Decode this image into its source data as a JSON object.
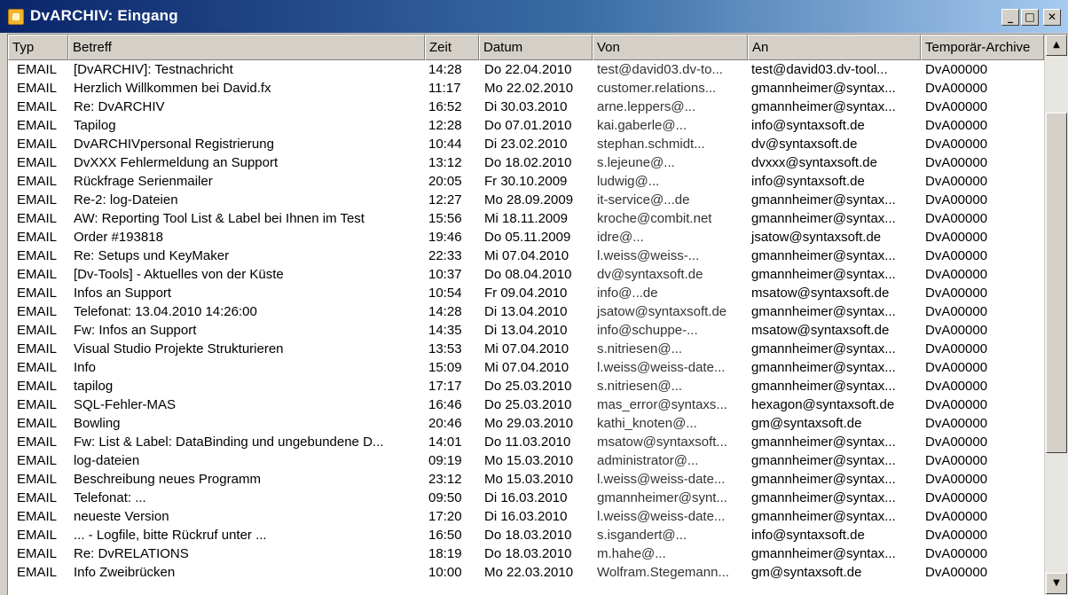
{
  "window": {
    "title": "DvARCHIV: Eingang",
    "buttons": {
      "minimize": "_",
      "maximize": "□",
      "close": "✕"
    }
  },
  "columns": [
    "Typ",
    "Betreff",
    "Zeit",
    "Datum",
    "Von",
    "An",
    "Temporär-Archive"
  ],
  "rows": [
    [
      "EMAIL",
      "[DvARCHIV]: Testnachricht",
      "14:28",
      "Do 22.04.2010",
      "test@david03.dv-to...",
      "test@david03.dv-tool...",
      "DvA00000"
    ],
    [
      "EMAIL",
      "Herzlich Willkommen bei David.fx",
      "11:17",
      "Mo 22.02.2010",
      "customer.relations...",
      "gmannheimer@syntax...",
      "DvA00000"
    ],
    [
      "EMAIL",
      "Re: DvARCHIV",
      "16:52",
      "Di 30.03.2010",
      "arne.leppers@...",
      "gmannheimer@syntax...",
      "DvA00000"
    ],
    [
      "EMAIL",
      "Tapilog",
      "12:28",
      "Do 07.01.2010",
      "kai.gaberle@...",
      "info@syntaxsoft.de",
      "DvA00000"
    ],
    [
      "EMAIL",
      "DvARCHIVpersonal Registrierung",
      "10:44",
      "Di 23.02.2010",
      "stephan.schmidt...",
      "dv@syntaxsoft.de",
      "DvA00000"
    ],
    [
      "EMAIL",
      "DvXXX Fehlermeldung an Support",
      "13:12",
      "Do 18.02.2010",
      "s.lejeune@...",
      "dvxxx@syntaxsoft.de",
      "DvA00000"
    ],
    [
      "EMAIL",
      "Rückfrage Serienmailer",
      "20:05",
      "Fr 30.10.2009",
      "ludwig@...",
      "info@syntaxsoft.de",
      "DvA00000"
    ],
    [
      "EMAIL",
      "Re-2: log-Dateien",
      "12:27",
      "Mo 28.09.2009",
      "it-service@...de",
      "gmannheimer@syntax...",
      "DvA00000"
    ],
    [
      "EMAIL",
      "AW: Reporting Tool List & Label bei Ihnen im Test",
      "15:56",
      "Mi 18.11.2009",
      "kroche@combit.net",
      "gmannheimer@syntax...",
      "DvA00000"
    ],
    [
      "EMAIL",
      "Order #193818",
      "19:46",
      "Do 05.11.2009",
      "idre@...",
      "jsatow@syntaxsoft.de",
      "DvA00000"
    ],
    [
      "EMAIL",
      "Re: Setups und KeyMaker",
      "22:33",
      "Mi 07.04.2010",
      "l.weiss@weiss-...",
      "gmannheimer@syntax...",
      "DvA00000"
    ],
    [
      "EMAIL",
      "[Dv-Tools] - Aktuelles von der Küste",
      "10:37",
      "Do 08.04.2010",
      "dv@syntaxsoft.de",
      "gmannheimer@syntax...",
      "DvA00000"
    ],
    [
      "EMAIL",
      "Infos an Support",
      "10:54",
      "Fr 09.04.2010",
      "info@...de",
      "msatow@syntaxsoft.de",
      "DvA00000"
    ],
    [
      "EMAIL",
      "Telefonat: 13.04.2010 14:26:00",
      "14:28",
      "Di 13.04.2010",
      "jsatow@syntaxsoft.de",
      "gmannheimer@syntax...",
      "DvA00000"
    ],
    [
      "EMAIL",
      "Fw: Infos an Support",
      "14:35",
      "Di 13.04.2010",
      "info@schuppe-...",
      "msatow@syntaxsoft.de",
      "DvA00000"
    ],
    [
      "EMAIL",
      "Visual Studio Projekte Strukturieren",
      "13:53",
      "Mi 07.04.2010",
      "s.nitriesen@...",
      "gmannheimer@syntax...",
      "DvA00000"
    ],
    [
      "EMAIL",
      "Info",
      "15:09",
      "Mi 07.04.2010",
      "l.weiss@weiss-date...",
      "gmannheimer@syntax...",
      "DvA00000"
    ],
    [
      "EMAIL",
      "tapilog",
      "17:17",
      "Do 25.03.2010",
      "s.nitriesen@...",
      "gmannheimer@syntax...",
      "DvA00000"
    ],
    [
      "EMAIL",
      "SQL-Fehler-MAS",
      "16:46",
      "Do 25.03.2010",
      "mas_error@syntaxs...",
      "hexagon@syntaxsoft.de",
      "DvA00000"
    ],
    [
      "EMAIL",
      "Bowling",
      "20:46",
      "Mo 29.03.2010",
      "kathi_knoten@...",
      "gm@syntaxsoft.de",
      "DvA00000"
    ],
    [
      "EMAIL",
      "Fw: List & Label: DataBinding und ungebundene D...",
      "14:01",
      "Do 11.03.2010",
      "msatow@syntaxsoft...",
      "gmannheimer@syntax...",
      "DvA00000"
    ],
    [
      "EMAIL",
      "log-dateien",
      "09:19",
      "Mo 15.03.2010",
      "administrator@...",
      "gmannheimer@syntax...",
      "DvA00000"
    ],
    [
      "EMAIL",
      "Beschreibung neues Programm",
      "23:12",
      "Mo 15.03.2010",
      "l.weiss@weiss-date...",
      "gmannheimer@syntax...",
      "DvA00000"
    ],
    [
      "EMAIL",
      "Telefonat: ...",
      "09:50",
      "Di 16.03.2010",
      "gmannheimer@synt...",
      "gmannheimer@syntax...",
      "DvA00000"
    ],
    [
      "EMAIL",
      "neueste Version",
      "17:20",
      "Di 16.03.2010",
      "l.weiss@weiss-date...",
      "gmannheimer@syntax...",
      "DvA00000"
    ],
    [
      "EMAIL",
      "... - Logfile, bitte Rückruf unter ...",
      "16:50",
      "Do 18.03.2010",
      "s.isgandert@...",
      "info@syntaxsoft.de",
      "DvA00000"
    ],
    [
      "EMAIL",
      "Re: DvRELATIONS",
      "18:19",
      "Do 18.03.2010",
      "m.hahe@...",
      "gmannheimer@syntax...",
      "DvA00000"
    ],
    [
      "EMAIL",
      "Info Zweibrücken",
      "10:00",
      "Mo 22.03.2010",
      "Wolfram.Stegemann...",
      "gm@syntaxsoft.de",
      "DvA00000"
    ]
  ],
  "scrollbar": {
    "up": "▲",
    "down": "▼"
  }
}
